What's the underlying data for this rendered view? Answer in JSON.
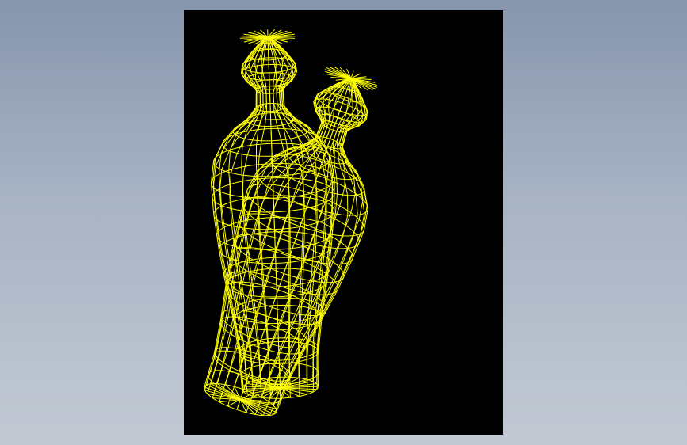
{
  "scene": {
    "background": "#000000",
    "wire_color": "#ffff00",
    "objects": [
      {
        "name": "vase-upright",
        "tilt_deg": -2,
        "meridians": 24,
        "profile": [
          [
            0,
            2
          ],
          [
            0.025,
            14
          ],
          [
            0.05,
            24
          ],
          [
            0.08,
            34
          ],
          [
            0.1,
            35
          ],
          [
            0.12,
            30
          ],
          [
            0.135,
            22
          ],
          [
            0.15,
            17
          ],
          [
            0.2,
            18
          ],
          [
            0.235,
            30
          ],
          [
            0.265,
            48
          ],
          [
            0.3,
            62
          ],
          [
            0.35,
            74
          ],
          [
            0.41,
            78
          ],
          [
            0.5,
            76
          ],
          [
            0.6,
            71
          ],
          [
            0.7,
            64
          ],
          [
            0.8,
            56
          ],
          [
            0.9,
            50
          ],
          [
            0.96,
            49
          ],
          [
            1,
            48
          ]
        ]
      },
      {
        "name": "vase-leaning",
        "tilt_deg": 19,
        "meridians": 24,
        "profile": [
          [
            0,
            2
          ],
          [
            0.025,
            13
          ],
          [
            0.05,
            23
          ],
          [
            0.08,
            34
          ],
          [
            0.1,
            35
          ],
          [
            0.12,
            30
          ],
          [
            0.135,
            22
          ],
          [
            0.15,
            17
          ],
          [
            0.2,
            18
          ],
          [
            0.235,
            30
          ],
          [
            0.265,
            48
          ],
          [
            0.3,
            62
          ],
          [
            0.35,
            74
          ],
          [
            0.41,
            78
          ],
          [
            0.5,
            76
          ],
          [
            0.6,
            71
          ],
          [
            0.7,
            64
          ],
          [
            0.8,
            56
          ],
          [
            0.9,
            50
          ],
          [
            0.96,
            49
          ],
          [
            1,
            48
          ]
        ]
      }
    ]
  }
}
